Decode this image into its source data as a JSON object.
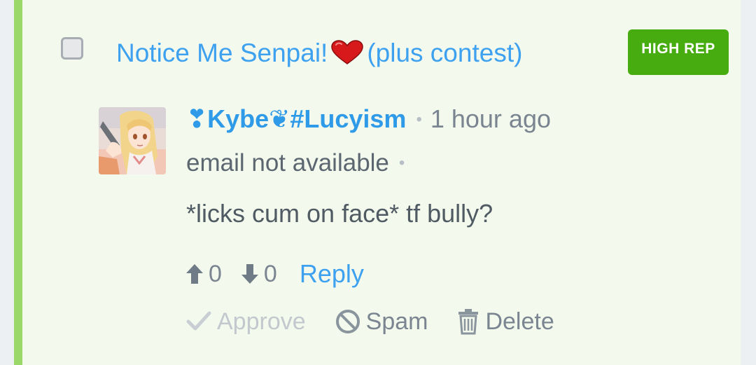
{
  "thread": {
    "title_prefix": "Notice Me Senpai!",
    "title_suffix": "(plus contest)",
    "badge": "HIGH REP"
  },
  "comment": {
    "author": "❣Kybe❦#Lucyism",
    "time": "1 hour ago",
    "email": "email not available",
    "separator": "•",
    "body": "*licks cum on face* tf bully?",
    "upvotes": "0",
    "downvotes": "0",
    "reply_label": "Reply"
  },
  "moderation": {
    "approve_label": "Approve",
    "spam_label": "Spam",
    "delete_label": "Delete"
  },
  "colors": {
    "accent_blue": "#3ea1f0",
    "badge_green": "#46ac0f",
    "card_border": "#9bd86a",
    "card_background": "#f3faed",
    "heart_red": "#d7191c"
  }
}
